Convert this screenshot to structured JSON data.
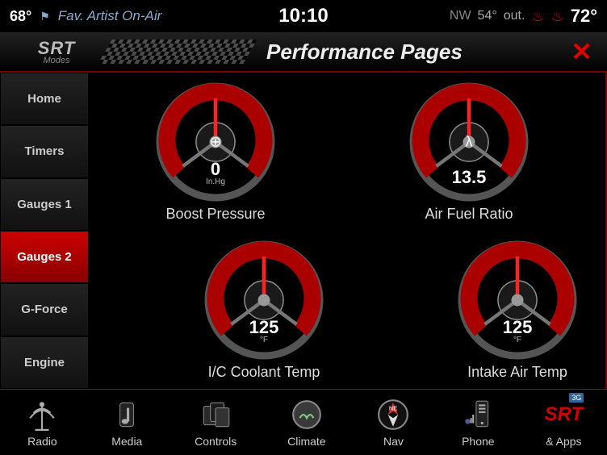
{
  "status": {
    "ext_temp": "68°",
    "artist_label": "Fav. Artist On-Air",
    "time": "10:10",
    "direction": "NW",
    "out_temp": "54°",
    "out_suffix": "out.",
    "cabin_temp": "72°"
  },
  "brand": {
    "name": "SRT",
    "sub": "Modes"
  },
  "header": {
    "title": "Performance Pages",
    "close": "✕"
  },
  "sidebar": {
    "items": [
      {
        "label": "Home",
        "active": false
      },
      {
        "label": "Timers",
        "active": false
      },
      {
        "label": "Gauges 1",
        "active": false
      },
      {
        "label": "Gauges 2",
        "active": true
      },
      {
        "label": "G-Force",
        "active": false
      },
      {
        "label": "Engine",
        "active": false
      }
    ]
  },
  "gauges": [
    {
      "label": "Boost Pressure",
      "value": "0",
      "unit": "In.Hg",
      "icon": "⊕"
    },
    {
      "label": "Air Fuel Ratio",
      "value": "13.5",
      "unit": "",
      "icon": "λ"
    },
    {
      "label": "I/C Coolant Temp",
      "value": "125",
      "unit": "°F",
      "icon": ""
    },
    {
      "label": "Intake Air Temp",
      "value": "125",
      "unit": "°F",
      "icon": ""
    }
  ],
  "nav": {
    "items": [
      {
        "label": "Radio"
      },
      {
        "label": "Media"
      },
      {
        "label": "Controls"
      },
      {
        "label": "Climate"
      },
      {
        "label": "Nav"
      },
      {
        "label": "Phone"
      },
      {
        "label": "& Apps"
      }
    ]
  },
  "badges": {
    "network": "3G",
    "srt": "SRT"
  }
}
